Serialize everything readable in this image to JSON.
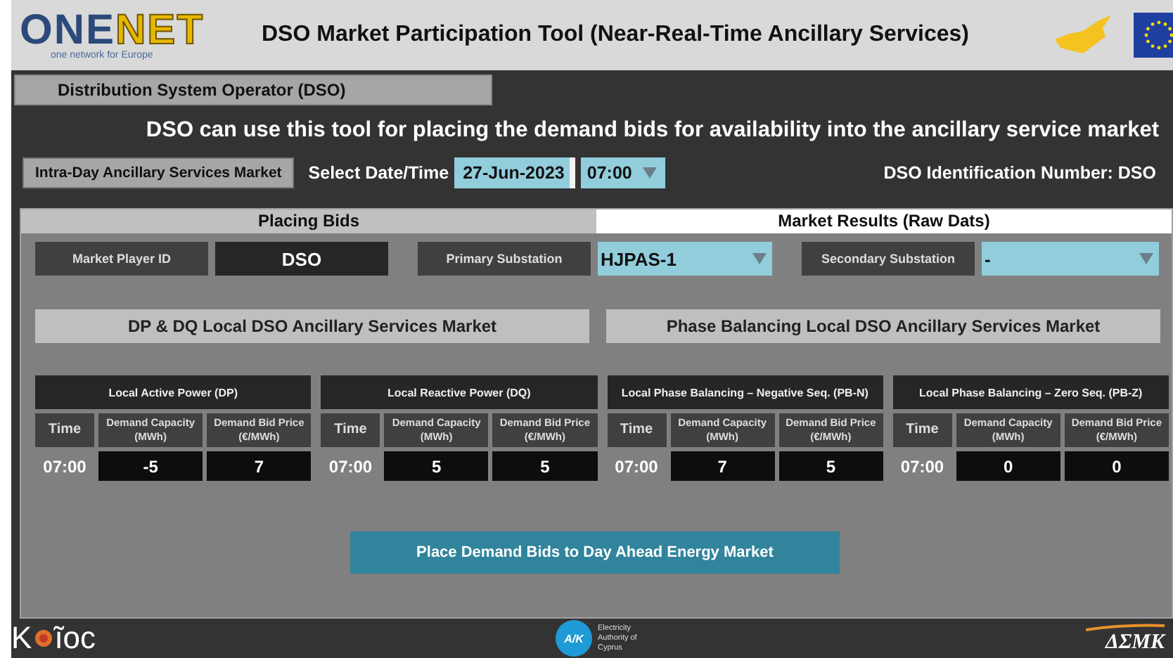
{
  "header": {
    "logo": {
      "part_1": "ONE",
      "part_2": "NET",
      "tagline": "one network for Europe"
    },
    "title": "DSO Market Participation Tool (Near-Real-Time Ancillary Services)"
  },
  "role_label": "Distribution System Operator (DSO)",
  "intro": "DSO can use this tool for placing the demand bids for availability into the ancillary service market",
  "controls": {
    "market_button": "Intra-Day Ancillary Services Market",
    "date_label": "Select Date/Time",
    "date": "27-Jun-2023",
    "time": "07:00",
    "dso_id": "DSO Identification Number: DSO"
  },
  "tabs": [
    {
      "label": "Placing Bids",
      "selected": true
    },
    {
      "label": "Market Results (Raw Dats)",
      "selected": false
    }
  ],
  "fields": [
    {
      "label": "Market Player ID",
      "value": "DSO",
      "kind": "text"
    },
    {
      "label": "Primary Substation",
      "value": "HJPAS-1",
      "kind": "dropdown"
    },
    {
      "label": "Secondary Substation",
      "value": "-",
      "kind": "dropdown"
    }
  ],
  "sections": [
    {
      "title": "DP & DQ Local DSO Ancillary Services Market"
    },
    {
      "title": "Phase Balancing Local DSO Ancillary Services Market"
    }
  ],
  "tables": [
    {
      "title": "Local Active Power (DP)",
      "columns": [
        "Time",
        "Demand Capacity (MWh)",
        "Demand Bid Price (€/MWh)"
      ],
      "rows": [
        [
          "07:00",
          "-5",
          "7"
        ]
      ]
    },
    {
      "title": "Local Reactive Power (DQ)",
      "columns": [
        "Time",
        "Demand Capacity (MWh)",
        "Demand Bid Price (€/MWh)"
      ],
      "rows": [
        [
          "07:00",
          "5",
          "5"
        ]
      ]
    },
    {
      "title": "Local Phase Balancing – Negative Seq. (PB-N)",
      "columns": [
        "Time",
        "Demand Capacity (MWh)",
        "Demand Bid Price (€/MWh)"
      ],
      "rows": [
        [
          "07:00",
          "7",
          "5"
        ]
      ]
    },
    {
      "title": "Local Phase Balancing – Zero Seq. (PB-Z)",
      "columns": [
        "Time",
        "Demand Capacity (MWh)",
        "Demand Bid Price (€/MWh)"
      ],
      "rows": [
        [
          "07:00",
          "0",
          "0"
        ]
      ]
    }
  ],
  "action_button": "Place Demand Bids to Day Ahead Energy Market",
  "footer": {
    "kios": {
      "part_1": "K",
      "part_2": "ĩoc"
    },
    "eac": {
      "mark": "A/K",
      "text": "Electricity Authority of Cyprus"
    },
    "dsmk": "ΔΣΜΚ"
  }
}
